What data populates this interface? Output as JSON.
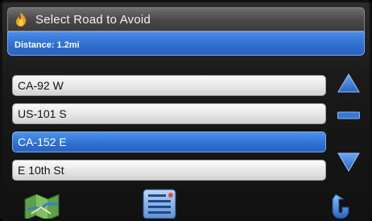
{
  "header": {
    "title": "Select Road to Avoid",
    "icon": "flame-logo-icon"
  },
  "distance": {
    "label": "Distance: 1.2mi"
  },
  "roads": [
    {
      "label": "CA-92 W",
      "selected": false
    },
    {
      "label": "US-101 S",
      "selected": false
    },
    {
      "label": "CA-152 E",
      "selected": true
    },
    {
      "label": "E 10th St",
      "selected": false
    }
  ],
  "scroll": {
    "up_icon": "arrow-up-icon",
    "middle_icon": "scroll-bar-icon",
    "down_icon": "arrow-down-icon"
  },
  "toolbar": {
    "map_icon": "map-icon",
    "list_icon": "list-icon",
    "back_icon": "back-arrow-icon"
  },
  "colors": {
    "accent": "#2f6fd0",
    "title_bar": "#4a4a4a"
  }
}
